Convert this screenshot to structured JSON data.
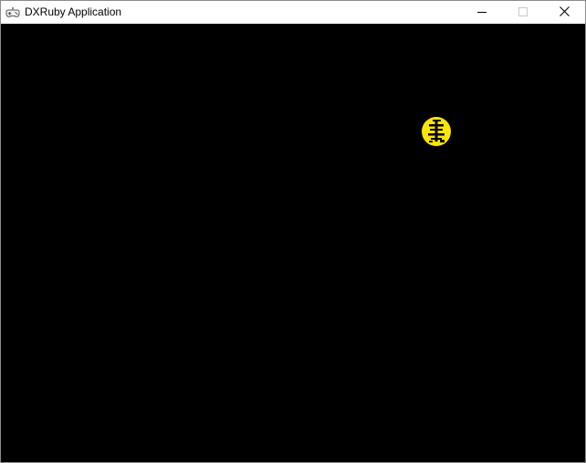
{
  "window": {
    "title": "DXRuby Application",
    "app_icon": "gamepad-icon",
    "controls": {
      "minimize_icon": "minimize-icon",
      "maximize_icon": "maximize-icon",
      "close_icon": "close-icon"
    }
  },
  "game": {
    "background_color": "#000000",
    "sprite": {
      "icon": "yellow-ball-sprite",
      "color": "#ffe600"
    }
  }
}
